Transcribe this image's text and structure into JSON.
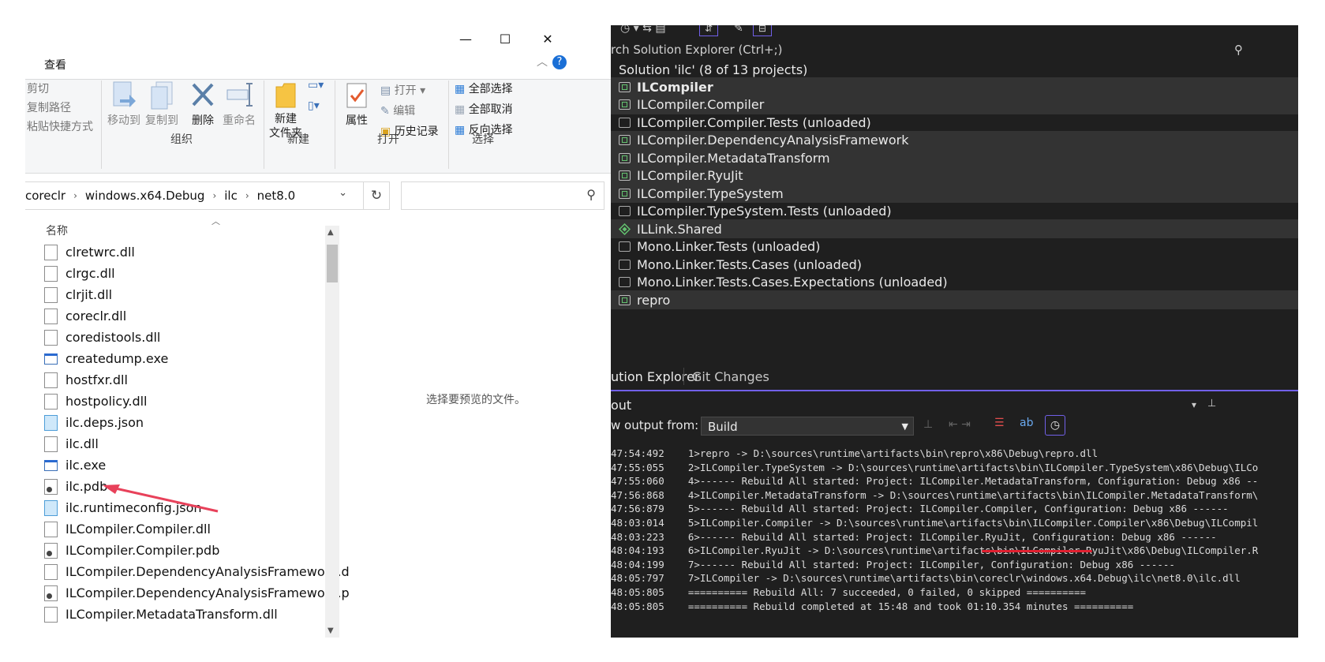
{
  "explorer": {
    "tab_view": "查看",
    "ribbon": {
      "clipboard": [
        "剪切",
        "复制路径",
        "粘贴快捷方式"
      ],
      "organize_buttons": [
        "移动到",
        "复制到",
        "删除",
        "重命名"
      ],
      "group_organize": "组织",
      "new_folder": "新建\n文件夹",
      "group_new": "新建",
      "properties": "属性",
      "open_items": [
        "打开",
        "编辑",
        "历史记录"
      ],
      "group_open": "打开",
      "select_items": [
        "全部选择",
        "全部取消",
        "反向选择"
      ],
      "group_select": "选择"
    },
    "breadcrumb": [
      "coreclr",
      "windows.x64.Debug",
      "ilc",
      "net8.0"
    ],
    "column_name": "名称",
    "files": [
      {
        "name": "clretwrc.dll",
        "type": "dll"
      },
      {
        "name": "clrgc.dll",
        "type": "dll"
      },
      {
        "name": "clrjit.dll",
        "type": "dll"
      },
      {
        "name": "coreclr.dll",
        "type": "dll"
      },
      {
        "name": "coredistools.dll",
        "type": "dll"
      },
      {
        "name": "createdump.exe",
        "type": "exe"
      },
      {
        "name": "hostfxr.dll",
        "type": "dll"
      },
      {
        "name": "hostpolicy.dll",
        "type": "dll"
      },
      {
        "name": "ilc.deps.json",
        "type": "json"
      },
      {
        "name": "ilc.dll",
        "type": "dll"
      },
      {
        "name": "ilc.exe",
        "type": "exe"
      },
      {
        "name": "ilc.pdb",
        "type": "pdb"
      },
      {
        "name": "ilc.runtimeconfig.json",
        "type": "json"
      },
      {
        "name": "ILCompiler.Compiler.dll",
        "type": "dll"
      },
      {
        "name": "ILCompiler.Compiler.pdb",
        "type": "pdb"
      },
      {
        "name": "ILCompiler.DependencyAnalysisFramework.d",
        "type": "dll"
      },
      {
        "name": "ILCompiler.DependencyAnalysisFramework.p",
        "type": "pdb"
      },
      {
        "name": "ILCompiler.MetadataTransform.dll",
        "type": "dll"
      }
    ],
    "preview_text": "选择要预览的文件。"
  },
  "vs": {
    "search_label": "rch Solution Explorer (Ctrl+;)",
    "solution_label": "Solution 'ilc' (8 of 13 projects)",
    "projects": [
      {
        "name": "ILCompiler",
        "kind": "cs",
        "bold": true
      },
      {
        "name": "ILCompiler.Compiler",
        "kind": "cs"
      },
      {
        "name": "ILCompiler.Compiler.Tests (unloaded)",
        "kind": "unloaded"
      },
      {
        "name": "ILCompiler.DependencyAnalysisFramework",
        "kind": "cs"
      },
      {
        "name": "ILCompiler.MetadataTransform",
        "kind": "cs"
      },
      {
        "name": "ILCompiler.RyuJit",
        "kind": "cs"
      },
      {
        "name": "ILCompiler.TypeSystem",
        "kind": "cs"
      },
      {
        "name": "ILCompiler.TypeSystem.Tests (unloaded)",
        "kind": "unloaded"
      },
      {
        "name": "ILLink.Shared",
        "kind": "shared"
      },
      {
        "name": "Mono.Linker.Tests (unloaded)",
        "kind": "unloaded"
      },
      {
        "name": "Mono.Linker.Tests.Cases (unloaded)",
        "kind": "unloaded"
      },
      {
        "name": "Mono.Linker.Tests.Cases.Expectations (unloaded)",
        "kind": "unloaded"
      },
      {
        "name": "repro",
        "kind": "cs"
      }
    ],
    "tabs": [
      "ution Explorer",
      "Git Changes"
    ],
    "output_title": "out",
    "output_from_label": "w output from:",
    "output_source": "Build",
    "log": [
      "47:54:492    1>repro -> D:\\sources\\runtime\\artifacts\\bin\\repro\\x86\\Debug\\repro.dll",
      "47:55:055    2>ILCompiler.TypeSystem -> D:\\sources\\runtime\\artifacts\\bin\\ILCompiler.TypeSystem\\x86\\Debug\\ILCo",
      "47:55:060    4>------ Rebuild All started: Project: ILCompiler.MetadataTransform, Configuration: Debug x86 --",
      "47:56:868    4>ILCompiler.MetadataTransform -> D:\\sources\\runtime\\artifacts\\bin\\ILCompiler.MetadataTransform\\",
      "47:56:879    5>------ Rebuild All started: Project: ILCompiler.Compiler, Configuration: Debug x86 ------",
      "48:03:014    5>ILCompiler.Compiler -> D:\\sources\\runtime\\artifacts\\bin\\ILCompiler.Compiler\\x86\\Debug\\ILCompil",
      "48:03:223    6>------ Rebuild All started: Project: ILCompiler.RyuJit, Configuration: Debug x86 ------",
      "48:04:193    6>ILCompiler.RyuJit -> D:\\sources\\runtime\\artifacts\\bin\\ILCompiler.RyuJit\\x86\\Debug\\ILCompiler.R",
      "48:04:199    7>------ Rebuild All started: Project: ILCompiler, Configuration: Debug x86 ------",
      "48:05:797    7>ILCompiler -> D:\\sources\\runtime\\artifacts\\bin\\coreclr\\windows.x64.Debug\\ilc\\net8.0\\ilc.dll",
      "48:05:805    ========== Rebuild All: 7 succeeded, 0 failed, 0 skipped ==========",
      "48:05:805    ========== Rebuild completed at 15:48 and took 01:10.354 minutes =========="
    ]
  }
}
